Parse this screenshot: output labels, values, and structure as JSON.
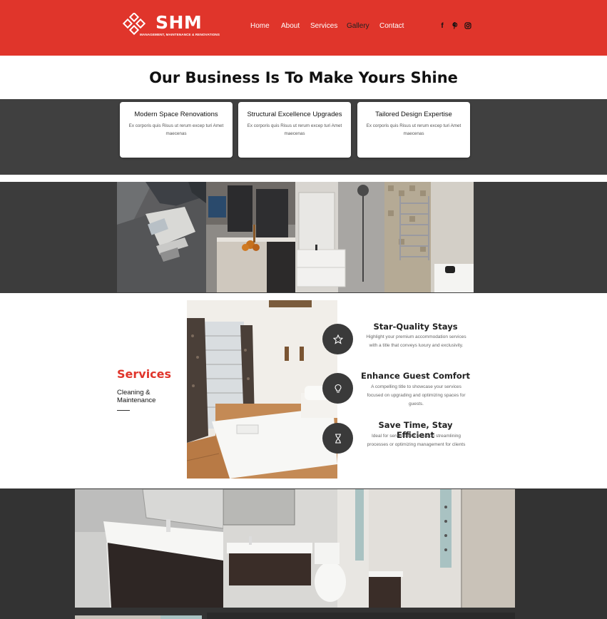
{
  "header": {
    "logo_text": "SHM",
    "logo_subtitle": "MANAGEMENT, MAINTENANCE & RENOVATIONS",
    "nav": [
      {
        "label": "Home"
      },
      {
        "label": "About"
      },
      {
        "label": "Services"
      },
      {
        "label": "Gallery"
      },
      {
        "label": "Contact"
      }
    ],
    "active_nav": "Gallery",
    "social_icons": [
      "facebook-icon",
      "pinterest-icon",
      "instagram-icon"
    ]
  },
  "hero": {
    "title": "Our Business Is To Make Yours Shine"
  },
  "features": [
    {
      "title": "Modern Space Renovations",
      "text": "Ex corporis quis Risus ut rerum excep turi Amet maecenas"
    },
    {
      "title": "Structural Excellence Upgrades",
      "text": "Ex corporis quis Risus ut rerum excep turi Amet maecenas"
    },
    {
      "title": "Tailored Design Expertise",
      "text": "Ex corporis quis Risus ut rerum excep turi Amet maecenas"
    }
  ],
  "services": {
    "title": "Services",
    "subtitle": "Cleaning & Maintenance",
    "items": [
      {
        "icon": "star-icon",
        "title": "Star-Quality Stays",
        "text": "Highlight your premium accommodation services with a title that conveys luxury and exclusivity."
      },
      {
        "icon": "lightbulb-icon",
        "title": "Enhance Guest Comfort",
        "text": "A compelling title to showcase your services focused on upgrading and optimizing spaces for guests."
      },
      {
        "icon": "hourglass-icon",
        "title": "Save Time, Stay Efficient",
        "text": "Ideal for services that focus on streamlining processes or optimizing management for clients"
      }
    ]
  },
  "colors": {
    "brand_red": "#e0352b",
    "dark_band": "#404040",
    "icon_circle": "#3a3a3a"
  }
}
